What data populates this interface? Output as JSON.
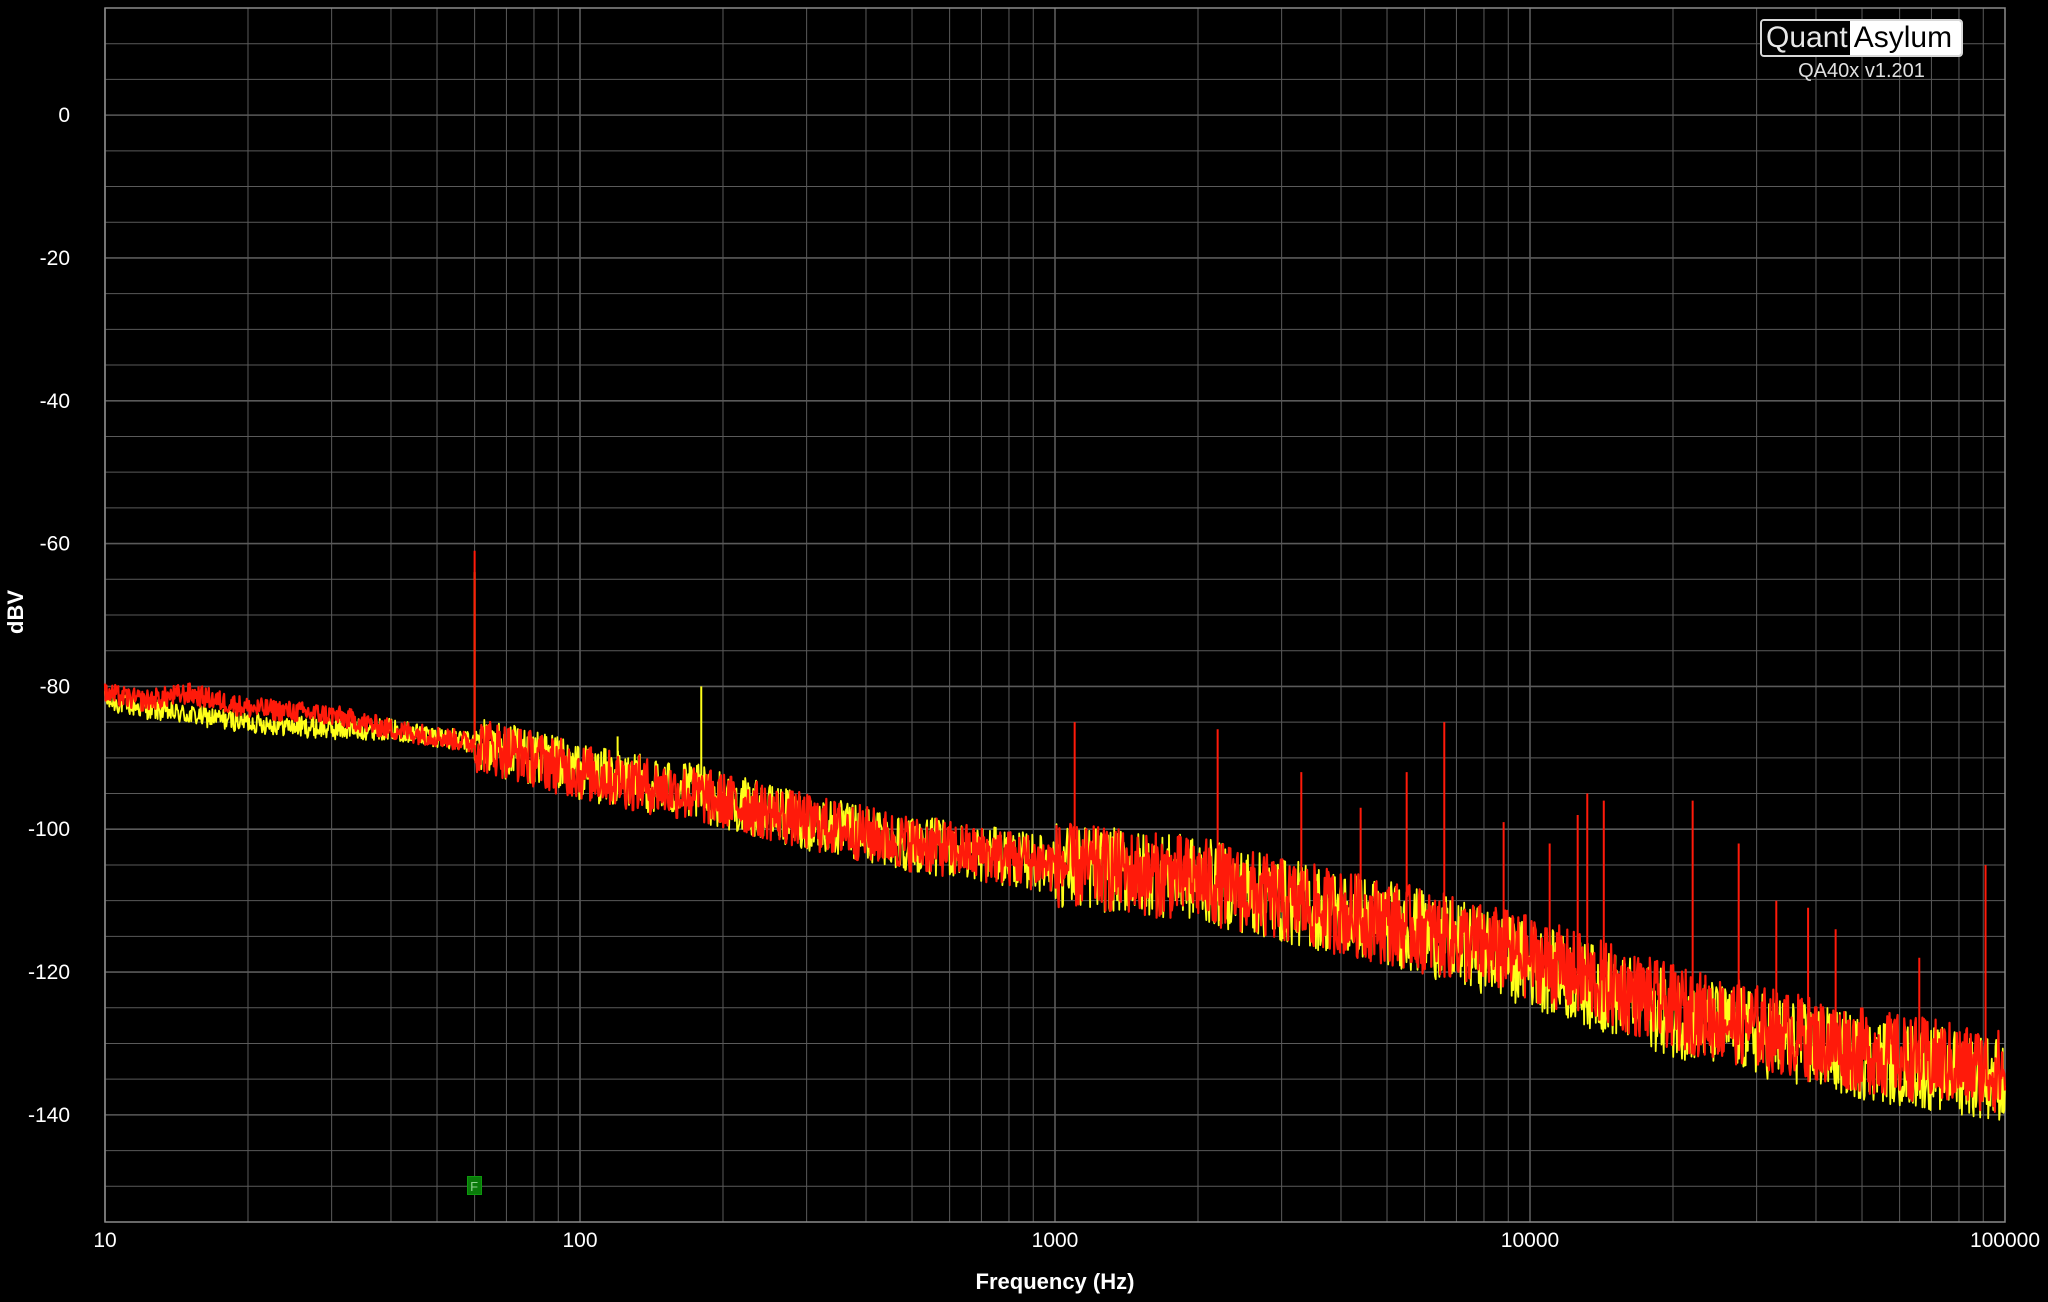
{
  "brand": {
    "logo_left": "Quant",
    "logo_right": "Asylum",
    "version": "QA40x v1.201"
  },
  "marker": {
    "label": "F",
    "frequency_hz": 60,
    "dbv": -150
  },
  "chart_data": {
    "type": "line",
    "title": "",
    "xlabel": "Frequency (Hz)",
    "ylabel": "dBV",
    "xscale": "log",
    "xlim": [
      10,
      100000
    ],
    "ylim": [
      -155,
      15
    ],
    "x_ticks": [
      10,
      100,
      1000,
      10000,
      100000
    ],
    "x_tick_labels": [
      "10",
      "100",
      "1000",
      "10000",
      "100000"
    ],
    "y_ticks": [
      0,
      -20,
      -40,
      -60,
      -80,
      -100,
      -120,
      -140
    ],
    "y_tick_labels": [
      "0",
      "-20",
      "-40",
      "-60",
      "-80",
      "-100",
      "-120",
      "-140"
    ],
    "grid": true,
    "background": "#000000",
    "grid_color": "#5a5a5a",
    "series": [
      {
        "color": "#ffff1a",
        "x": [
          10,
          12,
          15,
          20,
          30,
          40,
          50,
          60,
          70,
          100,
          180,
          200,
          300,
          500,
          1000,
          2000,
          3000,
          5000,
          10000,
          20000,
          50000,
          100000
        ],
        "y": [
          -82,
          -83,
          -84,
          -85,
          -86,
          -86,
          -87,
          -88,
          -89,
          -92,
          -95,
          -96,
          -99,
          -102,
          -105,
          -107,
          -110,
          -113,
          -119,
          -126,
          -132,
          -135
        ],
        "spikes": [
          {
            "x": 60,
            "y": -64
          },
          {
            "x": 120,
            "y": -87
          },
          {
            "x": 180,
            "y": -80
          }
        ]
      },
      {
        "color": "#ff1a0a",
        "x": [
          10,
          12,
          15,
          20,
          30,
          40,
          50,
          60,
          70,
          100,
          200,
          300,
          500,
          1000,
          2000,
          3000,
          5000,
          10000,
          20000,
          50000,
          100000
        ],
        "y": [
          -81,
          -82,
          -81,
          -83,
          -84,
          -86,
          -87,
          -88,
          -89,
          -92,
          -96,
          -99,
          -102,
          -105,
          -107,
          -110,
          -113,
          -118,
          -125,
          -131,
          -134
        ],
        "spikes": [
          {
            "x": 60,
            "y": -61
          },
          {
            "x": 1100,
            "y": -85
          },
          {
            "x": 2200,
            "y": -86
          },
          {
            "x": 3300,
            "y": -92
          },
          {
            "x": 4400,
            "y": -97
          },
          {
            "x": 5500,
            "y": -92
          },
          {
            "x": 6600,
            "y": -85
          },
          {
            "x": 8800,
            "y": -99
          },
          {
            "x": 11000,
            "y": -102
          },
          {
            "x": 12600,
            "y": -98
          },
          {
            "x": 13200,
            "y": -95
          },
          {
            "x": 14300,
            "y": -96
          },
          {
            "x": 22000,
            "y": -96
          },
          {
            "x": 27500,
            "y": -102
          },
          {
            "x": 33000,
            "y": -110
          },
          {
            "x": 38500,
            "y": -111
          },
          {
            "x": 44000,
            "y": -114
          },
          {
            "x": 66000,
            "y": -118
          },
          {
            "x": 91000,
            "y": -105
          }
        ]
      }
    ]
  }
}
